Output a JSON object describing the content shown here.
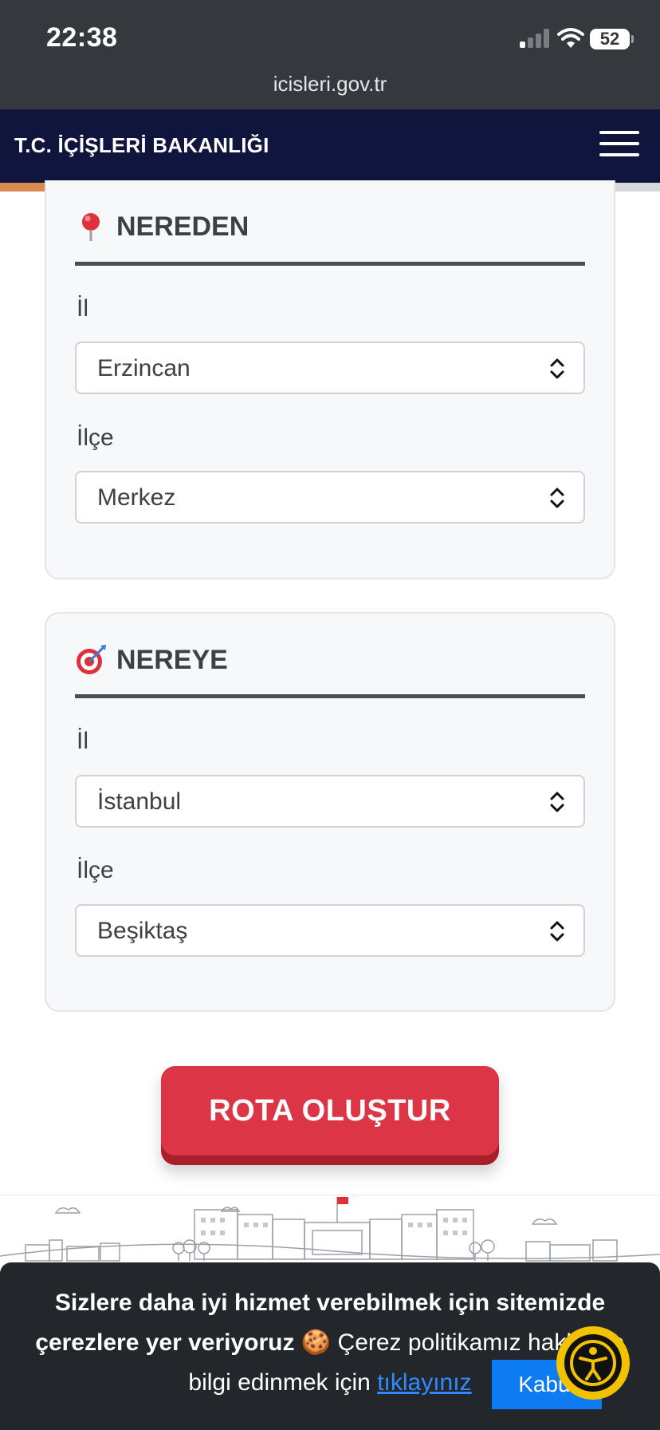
{
  "status_bar": {
    "time": "22:38",
    "battery": "52",
    "url": "icisleri.gov.tr"
  },
  "header": {
    "title": "T.C. İÇİŞLERİ BAKANLIĞI",
    "progress_fraction": 0.26
  },
  "nereden": {
    "title": "NEREDEN",
    "icon": "pushpin-icon",
    "il_label": "İl",
    "il_value": "Erzincan",
    "ilce_label": "İlçe",
    "ilce_value": "Merkez"
  },
  "nereye": {
    "title": "NEREYE",
    "icon": "dart-target-icon",
    "il_label": "İl",
    "il_value": "İstanbul",
    "ilce_label": "İlçe",
    "ilce_value": "Beşiktaş"
  },
  "action": {
    "rota_label": "ROTA OLUŞTUR"
  },
  "cookie": {
    "bold_text": "Sizlere daha iyi hizmet verebilmek için sitemizde çerezlere yer veriyoruz",
    "emoji": "🍪",
    "text_part1": "Çerez politikamız",
    "text_part2": "hakkında bilgi edinmek için",
    "link_text": "tıklayınız",
    "accept_label": "Kabul"
  },
  "colors": {
    "header_bg": "#10153d",
    "button_red": "#dc3545",
    "progress": "#d98a4f",
    "link_blue": "#2f8cff",
    "accept_blue": "#0d7cf2",
    "a11y_yellow": "#f2c200"
  }
}
